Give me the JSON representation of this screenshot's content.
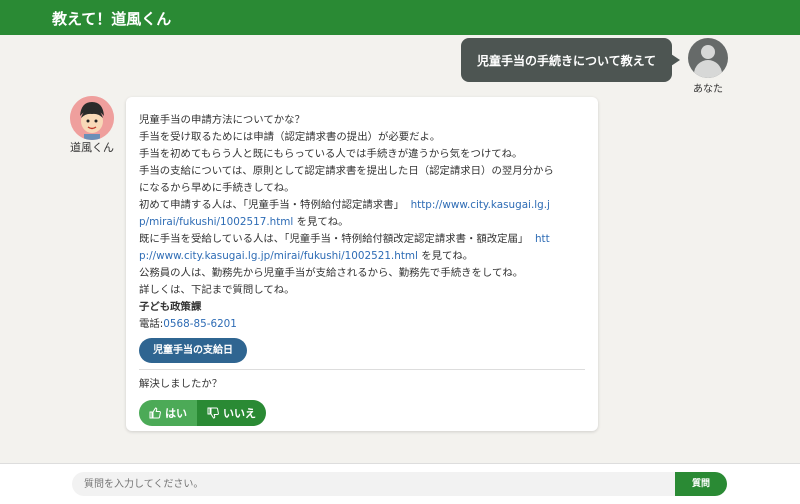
{
  "header": {
    "title": "教えて！道風くん"
  },
  "user": {
    "message": "児童手当の手続きについて教えて",
    "name": "あなた"
  },
  "bot": {
    "name": "道風くん",
    "lines": [
      "児童手当の申請方法についてかな？",
      "手当を受け取るためには申請（認定請求書の提出）が必要だよ。",
      "手当を初めてもらう人と既にもらっている人では手続きが違うから気をつけてね。",
      "手当の支給については、原則として認定請求書を提出した日（認定請求日）の翌月分から",
      "になるから早めに手続きしてね。"
    ],
    "line_first_pre": "初めて申請する人は、「児童手当・特例給付認定請求書」",
    "link1_part1": "http://www.city.kasugai.lg.j",
    "link1_part2": "p/mirai/fukushi/1002517.html",
    "line_first_post": "を見てね。",
    "line_second_pre": "既に手当を受給している人は、「児童手当・特例給付額改定認定請求書・額改定届」",
    "link2_part1": "htt",
    "link2_part2": "p://www.city.kasugai.lg.jp/mirai/fukushi/1002521.html",
    "line_second_post": "を見てね。",
    "line_public": "公務員の人は、勤務先から児童手当が支給されるから、勤務先で手続きをしてね。",
    "line_detail": "詳しくは、下記まで質問してね。",
    "department": "子ども政策課",
    "tel_label": "電話:",
    "tel_number": "0568-85-6201",
    "pay_button": "児童手当の支給日",
    "resolved_question": "解決しましたか？",
    "yes_label": "はい",
    "no_label": "いいえ"
  },
  "input": {
    "placeholder": "質問を入力してください。",
    "submit_label": "質問"
  },
  "colors": {
    "brand": "#2a8a34",
    "user_bubble": "#4d5552",
    "pay_button": "#2f6591",
    "link": "#2e6cb5"
  }
}
